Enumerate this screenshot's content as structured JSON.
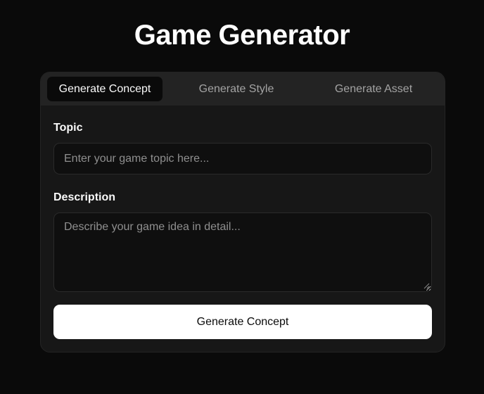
{
  "header": {
    "title": "Game Generator"
  },
  "tabs": [
    {
      "label": "Generate Concept",
      "active": true
    },
    {
      "label": "Generate Style",
      "active": false
    },
    {
      "label": "Generate Asset",
      "active": false
    }
  ],
  "form": {
    "topic_label": "Topic",
    "topic_placeholder": "Enter your game topic here...",
    "topic_value": "",
    "description_label": "Description",
    "description_placeholder": "Describe your game idea in detail...",
    "description_value": "",
    "submit_label": "Generate Concept"
  },
  "colors": {
    "background": "#0a0a0a",
    "card": "#171717",
    "tab_bar": "#232323",
    "active_tab": "#0a0a0a",
    "button": "#ffffff"
  }
}
